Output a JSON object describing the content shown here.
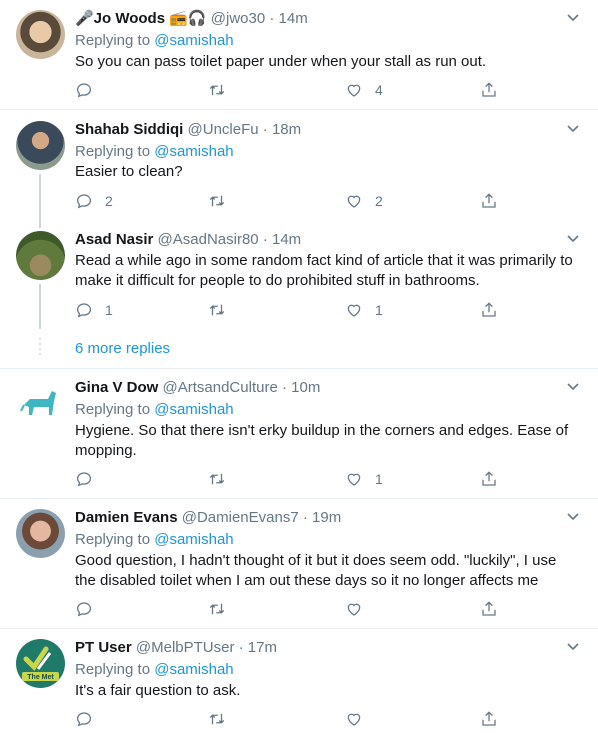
{
  "tweets": [
    {
      "name": "🎤Jo Woods 📻🎧",
      "handle": "@jwo30",
      "time": "14m",
      "replying_label": "Replying to",
      "replying_to": "@samishah",
      "text": "So you can pass toilet paper under when your stall as run out.",
      "reply_count": "",
      "retweet_count": "",
      "like_count": "4"
    },
    {
      "name": "Shahab Siddiqi",
      "handle": "@UncleFu",
      "time": "18m",
      "replying_label": "Replying to",
      "replying_to": "@samishah",
      "text": "Easier to clean?",
      "reply_count": "2",
      "retweet_count": "",
      "like_count": "2"
    },
    {
      "name": "Asad Nasir",
      "handle": "@AsadNasir80",
      "time": "14m",
      "text": "Read a while ago in some random fact kind of article that it was primarily to make it difficult for people to do prohibited stuff in bathrooms.",
      "reply_count": "1",
      "retweet_count": "",
      "like_count": "1"
    },
    {
      "name": "Gina V Dow",
      "handle": "@ArtsandCulture",
      "time": "10m",
      "replying_label": "Replying to",
      "replying_to": "@samishah",
      "text": "Hygiene. So that there isn't erky buildup in the corners and edges. Ease of mopping.",
      "reply_count": "",
      "retweet_count": "",
      "like_count": "1"
    },
    {
      "name": "Damien Evans",
      "handle": "@DamienEvans7",
      "time": "19m",
      "replying_label": "Replying to",
      "replying_to": "@samishah",
      "text": "Good question, I hadn't thought of it but it does seem odd. \"luckily\", I use the disabled toilet when I am out these days so it no longer affects me",
      "reply_count": "",
      "retweet_count": "",
      "like_count": ""
    },
    {
      "name": "PT User",
      "handle": "@MelbPTUser",
      "time": "17m",
      "replying_label": "Replying to",
      "replying_to": "@samishah",
      "text": "It's a fair question to ask.",
      "reply_count": "",
      "retweet_count": "",
      "like_count": ""
    }
  ],
  "more_replies": "6 more replies",
  "avatar_badge": "The Met",
  "dot": "·",
  "colors": {
    "link": "#1b95e0",
    "muted": "#657786",
    "border": "#e6ecf0"
  }
}
